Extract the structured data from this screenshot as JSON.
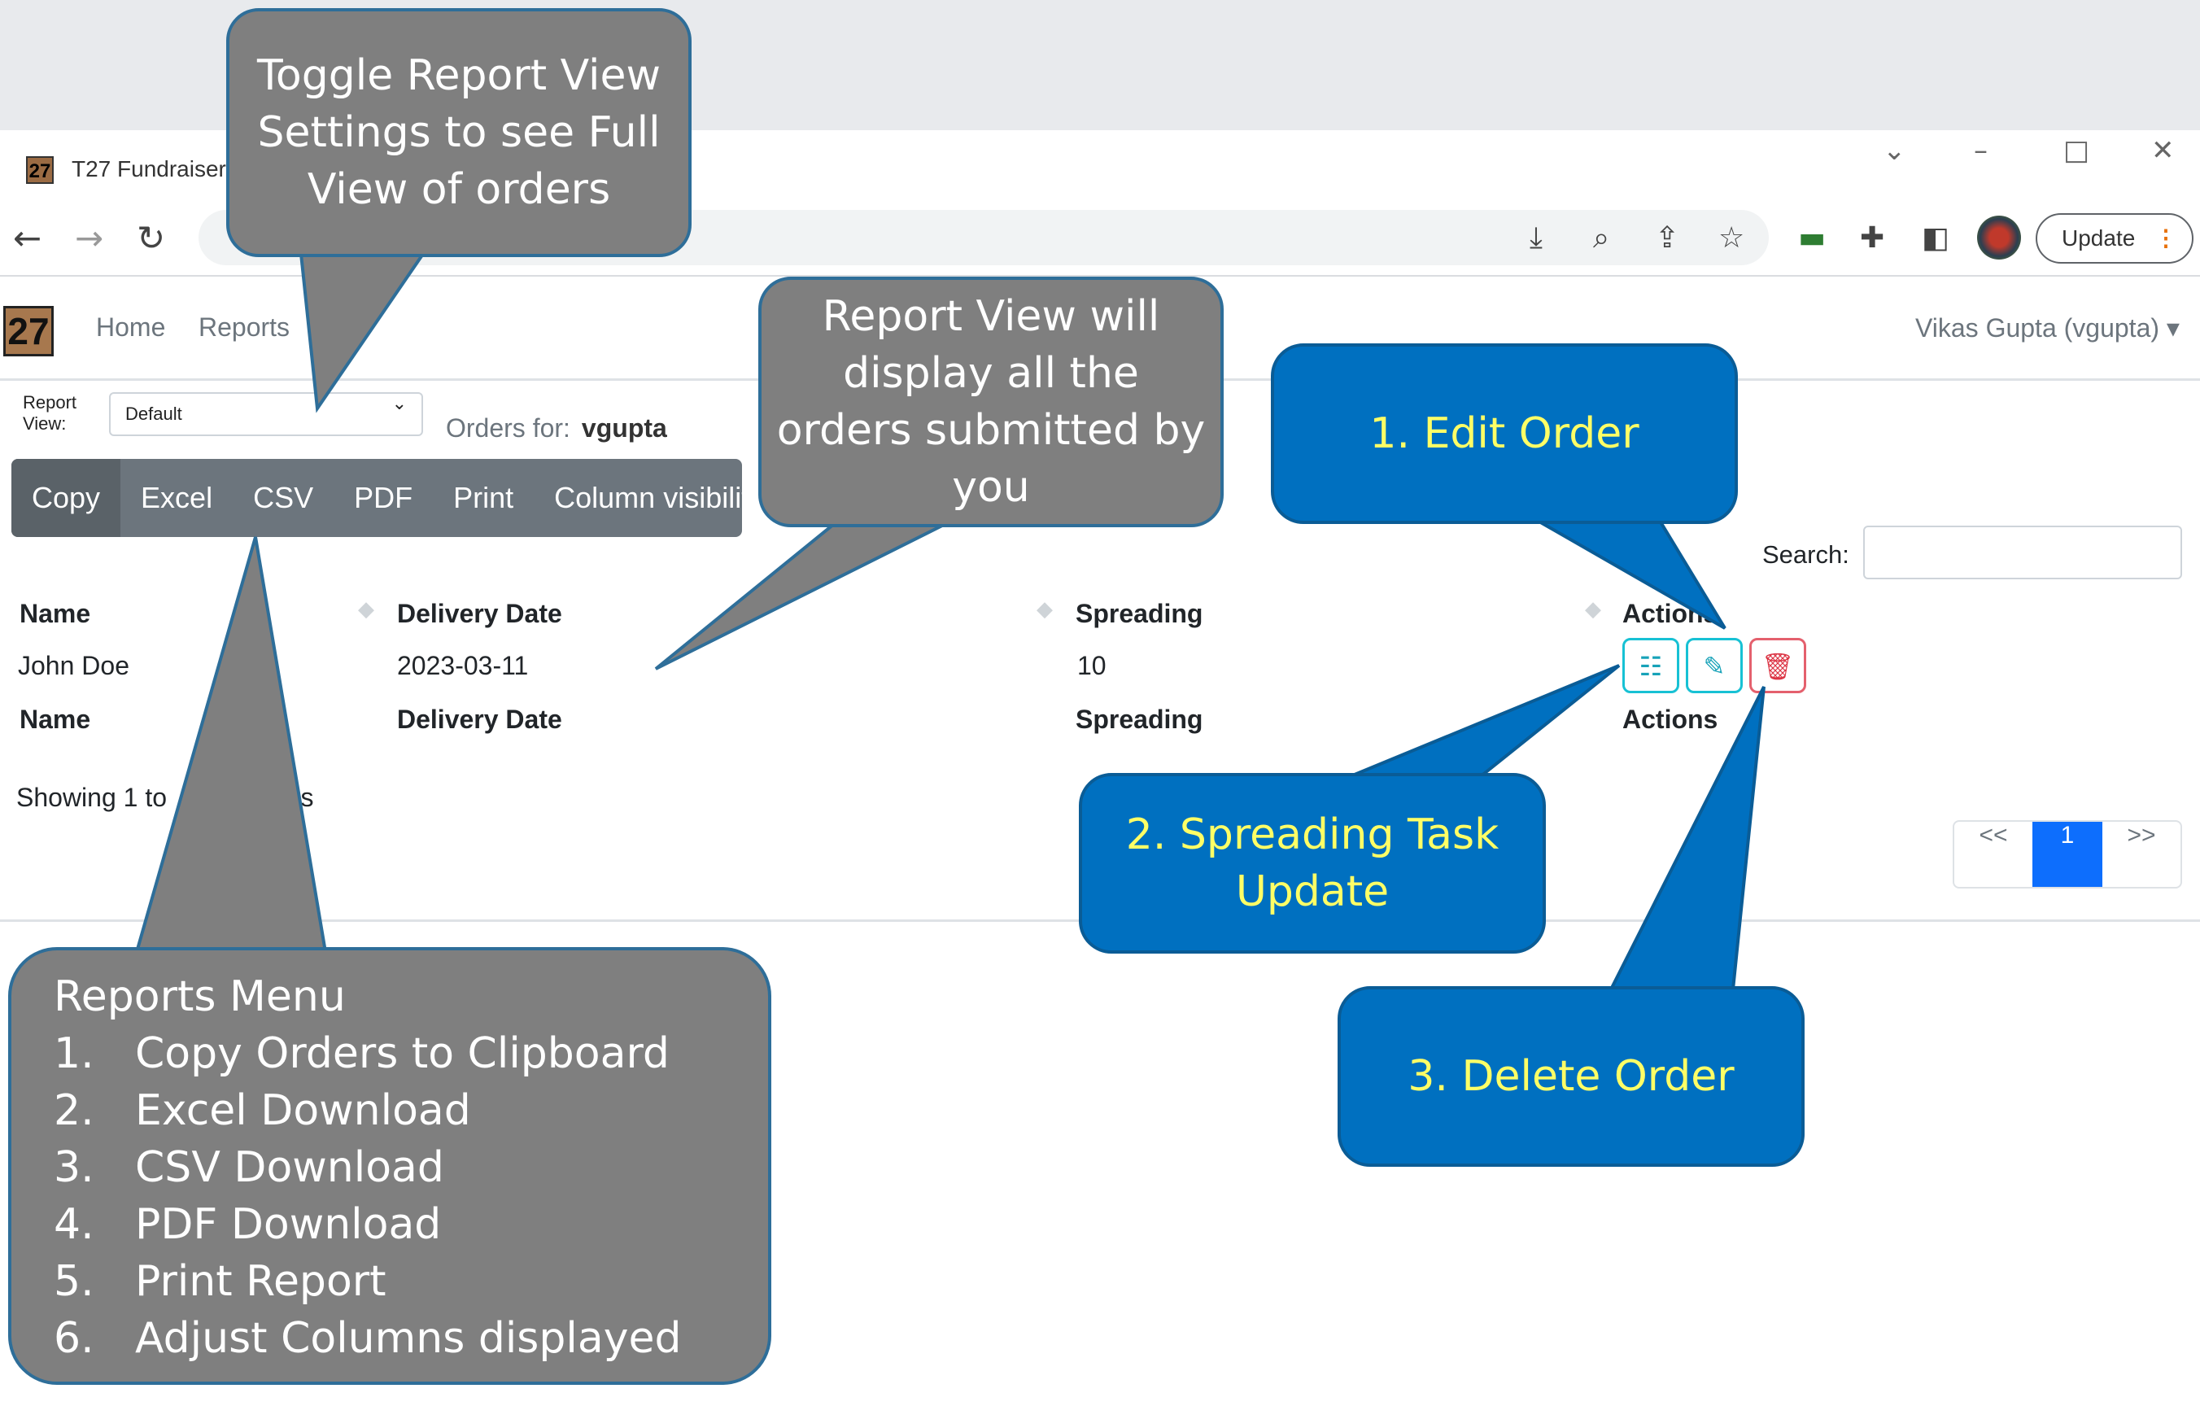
{
  "browser": {
    "tab_title": "T27 Fundraiser",
    "favicon_text": "27",
    "update_label": "Update",
    "icons": [
      "back-arrow-icon",
      "forward-arrow-icon",
      "reload-icon",
      "install-icon",
      "zoom-icon",
      "share-icon",
      "star-icon",
      "extension-icon",
      "puzzle-icon",
      "sidepanel-icon",
      "profile-avatar",
      "menu-dots-icon"
    ]
  },
  "app": {
    "logo_text": "27",
    "nav": {
      "home": "Home",
      "reports": "Reports"
    },
    "user": "Vikas Gupta (vgupta)"
  },
  "report": {
    "view_label": "Report View:",
    "view_value": "Default",
    "orders_for_label": "Orders for:",
    "orders_for_user": "vgupta",
    "buttons": [
      "Copy",
      "Excel",
      "CSV",
      "PDF",
      "Print",
      "Column visibility"
    ],
    "search_label": "Search:",
    "search_value": "",
    "columns": [
      "Name",
      "Delivery Date",
      "Spreading",
      "Actions"
    ],
    "rows": [
      {
        "name": "John Doe",
        "delivery_date": "2023-03-11",
        "spreading": "10"
      }
    ],
    "showing_left": "Showing 1 to",
    "showing_right": "tries",
    "pagination": {
      "prev": "<<",
      "current": "1",
      "next": ">>"
    }
  },
  "annotations": {
    "toggle_view": [
      "Toggle Report View",
      "Settings to see Full",
      "View of orders"
    ],
    "report_view": [
      "Report View will",
      "display all the",
      "orders submitted by",
      "you"
    ],
    "edit_order": "1. Edit Order",
    "spreading_task": [
      "2. Spreading Task",
      "Update"
    ],
    "delete_order": "3. Delete Order",
    "reports_menu": {
      "title": "Reports Menu",
      "items": [
        {
          "num": "1.",
          "label": "Copy Orders to Clipboard"
        },
        {
          "num": "2.",
          "label": "Excel Download"
        },
        {
          "num": "3.",
          "label": "CSV Download"
        },
        {
          "num": "4.",
          "label": "PDF Download"
        },
        {
          "num": "5.",
          "label": "Print Report"
        },
        {
          "num": "6.",
          "label": "Adjust Columns displayed"
        }
      ]
    }
  },
  "colors": {
    "callout_gray": "#7f7f7f",
    "callout_blue": "#0070c0",
    "callout_text_yellow": "#ffff66",
    "primary": "#0d6efd",
    "button_gray": "#6c757d"
  }
}
